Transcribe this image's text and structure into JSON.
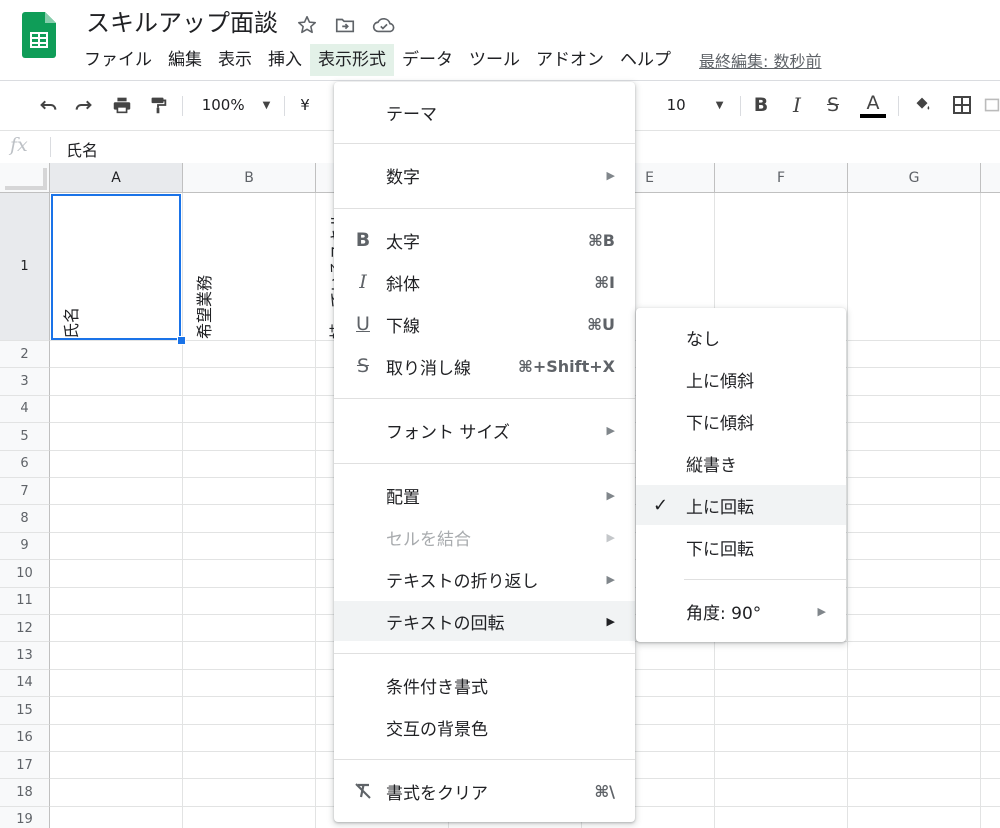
{
  "app": {
    "doc_title": "スキルアップ面談",
    "last_edit": "最終編集: 数秒前",
    "brand_color": "#0f9d58"
  },
  "menubar": [
    "ファイル",
    "編集",
    "表示",
    "挿入",
    "表示形式",
    "データ",
    "ツール",
    "アドオン",
    "ヘルプ"
  ],
  "menubar_active_index": 4,
  "toolbar": {
    "zoom": "100%",
    "currency": "¥",
    "font_size": "10"
  },
  "formula": {
    "label": "fx",
    "value": "氏名"
  },
  "grid": {
    "columns": [
      "A",
      "B",
      "",
      "",
      "E",
      "F",
      "G"
    ],
    "rows": [
      "1",
      "2",
      "3",
      "4",
      "5",
      "6",
      "7",
      "8",
      "9",
      "10",
      "11",
      "12",
      "13",
      "14",
      "15",
      "16",
      "17",
      "18",
      "19"
    ],
    "cells": {
      "A1": "氏名",
      "B1": "希望業務",
      "C1": "持っているスキル"
    },
    "selected_cell": "A1"
  },
  "format_menu": {
    "items": {
      "theme": "テーマ",
      "number": "数字",
      "bold": "太字",
      "bold_shortcut": "⌘B",
      "italic": "斜体",
      "italic_shortcut": "⌘I",
      "underline": "下線",
      "underline_shortcut": "⌘U",
      "strikethrough": "取り消し線",
      "strikethrough_shortcut": "⌘+Shift+X",
      "font_size": "フォント サイズ",
      "align": "配置",
      "merge": "セルを結合",
      "wrap": "テキストの折り返し",
      "rotation": "テキストの回転",
      "conditional": "条件付き書式",
      "alternating": "交互の背景色",
      "clear": "書式をクリア",
      "clear_shortcut": "⌘\\"
    }
  },
  "rotation_menu": {
    "options": [
      "なし",
      "上に傾斜",
      "下に傾斜",
      "縦書き",
      "上に回転",
      "下に回転"
    ],
    "checked_index": 4,
    "angle_label": "角度: 90°"
  }
}
